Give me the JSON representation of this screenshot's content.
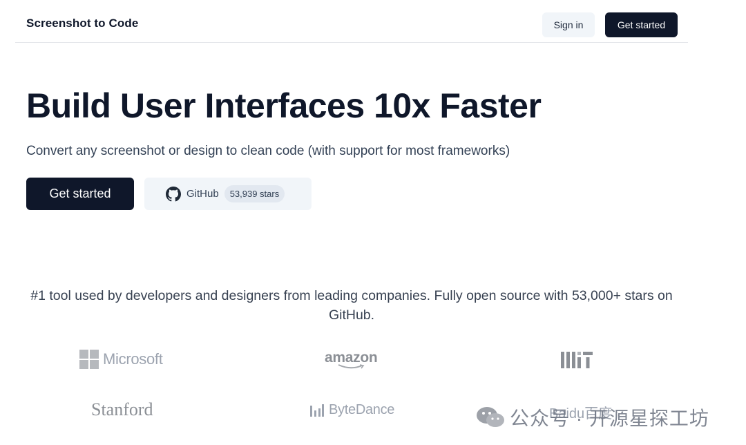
{
  "header": {
    "brand": "Screenshot to Code",
    "sign_in_label": "Sign in",
    "get_started_label": "Get started"
  },
  "hero": {
    "title": "Build User Interfaces 10x Faster",
    "subtitle": "Convert any screenshot or design to clean code (with support for most frameworks)",
    "cta_label": "Get started",
    "github_label": "GitHub",
    "github_stars": "53,939 stars"
  },
  "social_proof": {
    "text": "#1 tool used by developers and designers from leading companies. Fully open source with 53,000+ stars on GitHub."
  },
  "logos": {
    "microsoft": "Microsoft",
    "amazon": "amazon",
    "mit": "MIT",
    "stanford": "Stanford",
    "bytedance": "ByteDance",
    "baidu": "Baidu百度"
  },
  "watermark": {
    "text": "公众号 · 开源星探工坊"
  },
  "colors": {
    "primary": "#0f172a",
    "secondary_bg": "#f1f5f9",
    "logo_gray": "#9ca3af"
  }
}
